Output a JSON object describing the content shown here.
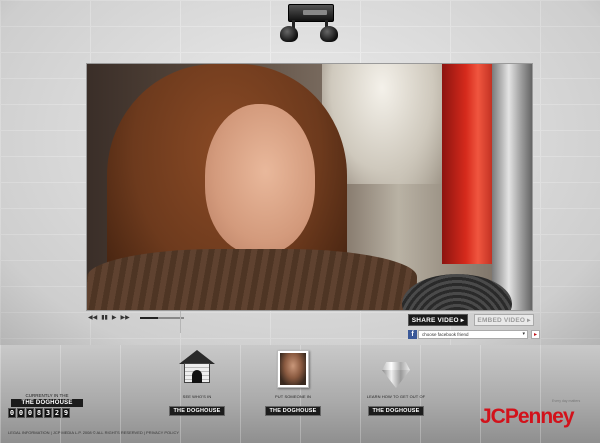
{
  "player": {
    "share_label": "SHARE VIDEO ▸",
    "embed_label": "EMBED VIDEO ▸",
    "progress": 0.42,
    "controls": [
      "◀◀",
      "▮▮",
      "▶",
      "▶▶"
    ]
  },
  "facebook": {
    "icon_letter": "f",
    "select_value": "choose facebook friend",
    "go": "▸"
  },
  "nav": {
    "see_whos_in": {
      "caption": "SEE WHO'S IN",
      "badge": "THE DOGHOUSE",
      "icon": "doghouse-icon"
    },
    "put_someone_in": {
      "caption": "PUT SOMEONE IN",
      "badge": "THE DOGHOUSE",
      "icon": "photo-icon"
    },
    "learn_how_out": {
      "caption": "LEARN HOW TO GET OUT OF",
      "badge": "THE DOGHOUSE",
      "icon": "diamond-icon"
    }
  },
  "counter": {
    "caption": "CURRENTLY IN THE",
    "title": "THE DOGHOUSE",
    "digits": [
      "0",
      "0",
      "0",
      "8",
      "3",
      "2",
      "9"
    ]
  },
  "footer": {
    "legal": "LEGAL INFORMATION  |  JCP MEDIA L.P. 2008 © ALL RIGHTS RESERVED  |  PRIVACY POLICY"
  },
  "brand": {
    "logo": "JCPenney",
    "tagline": "Every day matters"
  },
  "colors": {
    "brand_red": "#d2121b",
    "facebook_blue": "#3b5998"
  }
}
